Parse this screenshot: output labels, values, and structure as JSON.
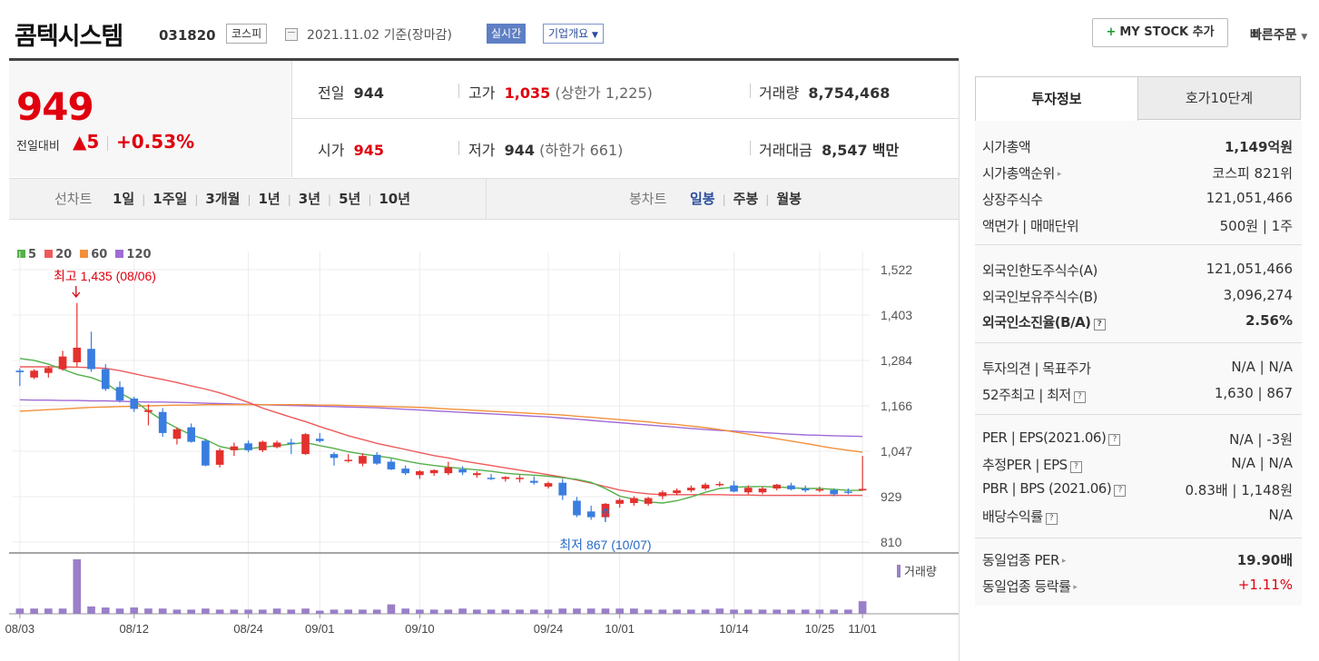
{
  "header": {
    "company": "콤텍시스템",
    "code": "031820",
    "market": "코스피",
    "date": "2021.11.02  기준(장마감)",
    "realtime": "실시간",
    "overview": "기업개요",
    "mystock_plus": "+",
    "mystock": "MY STOCK 추가",
    "quick_order": "빠른주문"
  },
  "price": {
    "current": "949",
    "change_label": "전일대비",
    "change_value": "▲5",
    "change_pct": "+0.53%"
  },
  "info": {
    "prev_label": "전일",
    "prev": "944",
    "high_label": "고가",
    "high": "1,035",
    "upper_limit": "(상한가 1,225)",
    "volume_label": "거래량",
    "volume": "8,754,468",
    "open_label": "시가",
    "open": "945",
    "low_label": "저가",
    "low": "944",
    "lower_limit": "(하한가 661)",
    "amount_label": "거래대금",
    "amount": "8,547",
    "amount_unit": "백만"
  },
  "tabs": {
    "line_chart": "선차트",
    "periods": [
      "1일",
      "1주일",
      "3개월",
      "1년",
      "3년",
      "5년",
      "10년"
    ],
    "candle_chart": "봉차트",
    "candles": [
      "일봉",
      "주봉",
      "월봉"
    ]
  },
  "colors": {
    "up": "#e3312e",
    "down": "#3a7de0",
    "ma5": "#54b04a",
    "ma20": "#ee5a5a",
    "ma60": "#f3913a",
    "ma120": "#a06bd6",
    "volume": "#9a7fc9"
  },
  "chart_data": {
    "type": "candlestick",
    "legend": [
      "5",
      "20",
      "60",
      "120"
    ],
    "y_ticks": [
      "1,522",
      "1,403",
      "1,284",
      "1,166",
      "1,047",
      "929",
      "810"
    ],
    "ylim": [
      810,
      1522
    ],
    "x_ticks": [
      "08/03",
      "08/12",
      "08/24",
      "09/01",
      "09/10",
      "09/24",
      "10/01",
      "10/14",
      "10/25",
      "11/01"
    ],
    "high_annotation": "최고 1,435 (08/06)",
    "low_annotation": "최저 867 (10/07)",
    "volume_label": "거래량",
    "candles": [
      {
        "o": 1258,
        "h": 1264,
        "l": 1218,
        "c": 1254
      },
      {
        "o": 1240,
        "h": 1262,
        "l": 1236,
        "c": 1258
      },
      {
        "o": 1252,
        "h": 1270,
        "l": 1240,
        "c": 1265
      },
      {
        "o": 1262,
        "h": 1310,
        "l": 1258,
        "c": 1295
      },
      {
        "o": 1280,
        "h": 1435,
        "l": 1268,
        "c": 1318
      },
      {
        "o": 1315,
        "h": 1360,
        "l": 1255,
        "c": 1262
      },
      {
        "o": 1262,
        "h": 1275,
        "l": 1205,
        "c": 1210
      },
      {
        "o": 1215,
        "h": 1230,
        "l": 1175,
        "c": 1180
      },
      {
        "o": 1185,
        "h": 1190,
        "l": 1150,
        "c": 1158
      },
      {
        "o": 1150,
        "h": 1170,
        "l": 1115,
        "c": 1155
      },
      {
        "o": 1150,
        "h": 1160,
        "l": 1085,
        "c": 1095
      },
      {
        "o": 1080,
        "h": 1110,
        "l": 1065,
        "c": 1105
      },
      {
        "o": 1110,
        "h": 1120,
        "l": 1070,
        "c": 1072
      },
      {
        "o": 1075,
        "h": 1080,
        "l": 1008,
        "c": 1010
      },
      {
        "o": 1012,
        "h": 1055,
        "l": 1005,
        "c": 1050
      },
      {
        "o": 1050,
        "h": 1070,
        "l": 1035,
        "c": 1060
      },
      {
        "o": 1068,
        "h": 1075,
        "l": 1045,
        "c": 1050
      },
      {
        "o": 1050,
        "h": 1075,
        "l": 1045,
        "c": 1072
      },
      {
        "o": 1058,
        "h": 1075,
        "l": 1055,
        "c": 1070
      },
      {
        "o": 1070,
        "h": 1080,
        "l": 1040,
        "c": 1068
      },
      {
        "o": 1040,
        "h": 1095,
        "l": 1038,
        "c": 1092
      },
      {
        "o": 1080,
        "h": 1095,
        "l": 1070,
        "c": 1074
      },
      {
        "o": 1040,
        "h": 1045,
        "l": 1010,
        "c": 1030
      },
      {
        "o": 1025,
        "h": 1040,
        "l": 1018,
        "c": 1025
      },
      {
        "o": 1015,
        "h": 1042,
        "l": 1008,
        "c": 1035
      },
      {
        "o": 1038,
        "h": 1045,
        "l": 1012,
        "c": 1015
      },
      {
        "o": 1020,
        "h": 1028,
        "l": 998,
        "c": 1000
      },
      {
        "o": 1002,
        "h": 1010,
        "l": 985,
        "c": 990
      },
      {
        "o": 985,
        "h": 998,
        "l": 975,
        "c": 995
      },
      {
        "o": 990,
        "h": 1000,
        "l": 983,
        "c": 998
      },
      {
        "o": 990,
        "h": 1020,
        "l": 985,
        "c": 1005
      },
      {
        "o": 1000,
        "h": 1008,
        "l": 985,
        "c": 992
      },
      {
        "o": 985,
        "h": 995,
        "l": 978,
        "c": 990
      },
      {
        "o": 978,
        "h": 988,
        "l": 972,
        "c": 975
      },
      {
        "o": 975,
        "h": 982,
        "l": 968,
        "c": 980
      },
      {
        "o": 975,
        "h": 985,
        "l": 966,
        "c": 978
      },
      {
        "o": 970,
        "h": 982,
        "l": 960,
        "c": 965
      },
      {
        "o": 955,
        "h": 968,
        "l": 950,
        "c": 964
      },
      {
        "o": 965,
        "h": 975,
        "l": 920,
        "c": 932
      },
      {
        "o": 918,
        "h": 928,
        "l": 875,
        "c": 880
      },
      {
        "o": 890,
        "h": 905,
        "l": 868,
        "c": 875
      },
      {
        "o": 875,
        "h": 912,
        "l": 867,
        "c": 910
      },
      {
        "o": 910,
        "h": 925,
        "l": 900,
        "c": 920
      },
      {
        "o": 912,
        "h": 930,
        "l": 905,
        "c": 925
      },
      {
        "o": 910,
        "h": 928,
        "l": 905,
        "c": 925
      },
      {
        "o": 930,
        "h": 945,
        "l": 922,
        "c": 940
      },
      {
        "o": 938,
        "h": 950,
        "l": 932,
        "c": 945
      },
      {
        "o": 945,
        "h": 958,
        "l": 940,
        "c": 952
      },
      {
        "o": 950,
        "h": 965,
        "l": 945,
        "c": 960
      },
      {
        "o": 962,
        "h": 968,
        "l": 955,
        "c": 962
      },
      {
        "o": 958,
        "h": 970,
        "l": 940,
        "c": 942
      },
      {
        "o": 940,
        "h": 958,
        "l": 935,
        "c": 952
      },
      {
        "o": 940,
        "h": 955,
        "l": 935,
        "c": 950
      },
      {
        "o": 950,
        "h": 962,
        "l": 945,
        "c": 960
      },
      {
        "o": 958,
        "h": 965,
        "l": 945,
        "c": 948
      },
      {
        "o": 950,
        "h": 958,
        "l": 940,
        "c": 945
      },
      {
        "o": 945,
        "h": 955,
        "l": 940,
        "c": 948
      },
      {
        "o": 946,
        "h": 950,
        "l": 930,
        "c": 935
      },
      {
        "o": 942,
        "h": 950,
        "l": 935,
        "c": 940
      },
      {
        "o": 945,
        "h": 1035,
        "l": 944,
        "c": 949
      }
    ],
    "ma5": [
      1290,
      1285,
      1275,
      1262,
      1248,
      1240,
      1226,
      1200,
      1180,
      1152,
      1128,
      1108,
      1090,
      1078,
      1060,
      1052,
      1054,
      1058,
      1062,
      1066,
      1070,
      1062,
      1055,
      1046,
      1040,
      1035,
      1030,
      1022,
      1015,
      1010,
      1006,
      1002,
      999,
      995,
      990,
      987,
      985,
      982,
      978,
      974,
      966,
      950,
      930,
      922,
      915,
      912,
      918,
      928,
      940,
      950,
      953,
      955,
      955,
      954,
      952,
      950,
      950,
      948,
      945,
      945
    ],
    "ma20": [
      1268,
      1268,
      1268,
      1268,
      1267,
      1266,
      1264,
      1258,
      1250,
      1242,
      1235,
      1227,
      1218,
      1210,
      1200,
      1188,
      1175,
      1160,
      1148,
      1136,
      1125,
      1112,
      1100,
      1088,
      1078,
      1068,
      1060,
      1052,
      1044,
      1036,
      1030,
      1022,
      1016,
      1010,
      1004,
      998,
      992,
      986,
      980,
      972,
      964,
      955,
      946,
      940,
      936,
      934,
      934,
      934,
      934,
      934,
      933,
      933,
      932,
      932,
      932,
      932,
      932,
      932,
      932,
      932
    ],
    "ma60": [
      1152,
      1154,
      1156,
      1158,
      1160,
      1162,
      1163,
      1164,
      1165,
      1166,
      1167,
      1168,
      1168,
      1169,
      1169,
      1169,
      1169,
      1169,
      1169,
      1169,
      1169,
      1168,
      1168,
      1167,
      1166,
      1165,
      1164,
      1163,
      1162,
      1160,
      1158,
      1156,
      1154,
      1152,
      1150,
      1148,
      1146,
      1144,
      1142,
      1139,
      1136,
      1133,
      1130,
      1127,
      1124,
      1120,
      1117,
      1113,
      1109,
      1104,
      1098,
      1092,
      1086,
      1080,
      1074,
      1068,
      1061,
      1055,
      1050,
      1045
    ],
    "ma120": [
      1182,
      1181,
      1181,
      1180,
      1180,
      1179,
      1179,
      1178,
      1177,
      1176,
      1176,
      1175,
      1174,
      1173,
      1172,
      1171,
      1170,
      1169,
      1168,
      1167,
      1166,
      1165,
      1164,
      1163,
      1162,
      1161,
      1159,
      1157,
      1155,
      1153,
      1151,
      1149,
      1147,
      1145,
      1143,
      1141,
      1139,
      1137,
      1134,
      1131,
      1128,
      1125,
      1122,
      1119,
      1116,
      1113,
      1110,
      1107,
      1104,
      1102,
      1100,
      1098,
      1096,
      1094,
      1092,
      1090,
      1089,
      1088,
      1087,
      1086
    ],
    "volume": [
      5,
      5,
      5,
      5,
      52,
      7,
      6,
      5,
      6,
      5,
      5,
      4,
      4,
      5,
      4,
      4,
      4,
      4,
      5,
      4,
      5,
      3,
      4,
      4,
      4,
      4,
      9,
      5,
      4,
      4,
      4,
      5,
      4,
      4,
      4,
      4,
      4,
      4,
      5,
      5,
      5,
      5,
      5,
      5,
      4,
      4,
      4,
      4,
      4,
      5,
      4,
      4,
      4,
      4,
      4,
      4,
      4,
      4,
      4,
      12
    ]
  },
  "right_panel": {
    "tab_active": "투자정보",
    "tab_other": "호가10단계",
    "rows": [
      {
        "k": "시가총액",
        "v": "1,149억원"
      },
      {
        "k": "시가총액순위",
        "v": "코스피 821위"
      },
      {
        "k": "상장주식수",
        "v": "121,051,466"
      },
      {
        "k": "액면가 | 매매단위",
        "v": "500원 | 1주"
      },
      {
        "k": "외국인한도주식수(A)",
        "v": "121,051,466"
      },
      {
        "k": "외국인보유주식수(B)",
        "v": "3,096,274"
      },
      {
        "k": "외국인소진율(B/A)",
        "v": "2.56%"
      },
      {
        "k": "투자의견 | 목표주가",
        "v": "N/A | N/A"
      },
      {
        "k": "52주최고 | 최저",
        "v": "1,630 | 867"
      },
      {
        "k": "PER | EPS(2021.06)",
        "v": "N/A | -3원"
      },
      {
        "k": "추정PER | EPS",
        "v": "N/A | N/A"
      },
      {
        "k": "PBR | BPS (2021.06)",
        "v": "0.83배 | 1,148원"
      },
      {
        "k": "배당수익률",
        "v": "N/A"
      },
      {
        "k": "동일업종 PER",
        "v": "19.90배"
      },
      {
        "k": "동일업종 등락률",
        "v": "+1.11%"
      }
    ],
    "help": "?",
    "arrow": "▸"
  }
}
